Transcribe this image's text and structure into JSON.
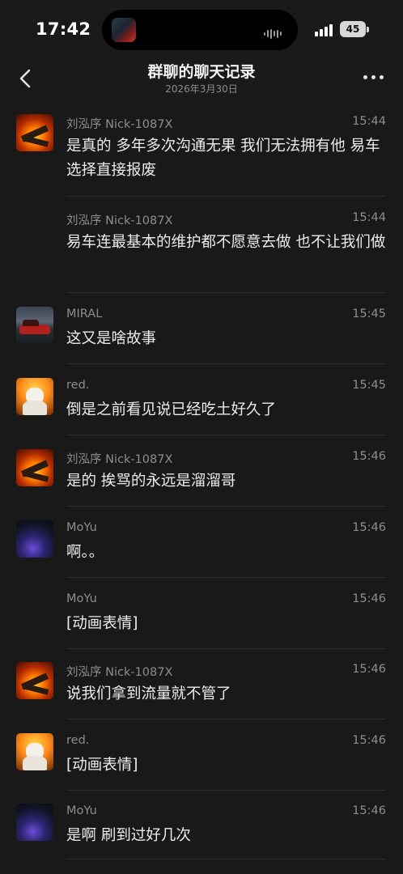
{
  "status_bar": {
    "time": "17:42",
    "battery": "45"
  },
  "header": {
    "title": "群聊的聊天记录",
    "subtitle": "2026年3月30日",
    "back_icon": "chevron-left-icon",
    "more_icon": "more-horizontal-icon"
  },
  "messages": [
    {
      "sender": "刘泓序 Nick-1087X",
      "time": "15:44",
      "text": "是真的 多年多次沟通无果 我们无法拥有他 易车选择直接报废",
      "avatar": "fire",
      "show_avatar": true
    },
    {
      "sender": "刘泓序 Nick-1087X",
      "time": "15:44",
      "text": "易车连最基本的维护都不愿意去做  也不让我们做",
      "avatar": "fire",
      "show_avatar": false
    },
    {
      "sender": "MIRAL",
      "time": "15:45",
      "text": "这又是啥故事",
      "avatar": "car",
      "show_avatar": true
    },
    {
      "sender": "red.",
      "time": "15:45",
      "text": "倒是之前看见说已经吃土好久了",
      "avatar": "cat",
      "show_avatar": true
    },
    {
      "sender": "刘泓序 Nick-1087X",
      "time": "15:46",
      "text": "是的  挨骂的永远是溜溜哥",
      "avatar": "fire",
      "show_avatar": true
    },
    {
      "sender": "MoYu",
      "time": "15:46",
      "text": "啊。。",
      "avatar": "dark",
      "show_avatar": true
    },
    {
      "sender": "MoYu",
      "time": "15:46",
      "text": "[动画表情]",
      "avatar": "dark",
      "show_avatar": false
    },
    {
      "sender": "刘泓序 Nick-1087X",
      "time": "15:46",
      "text": "说我们拿到流量就不管了",
      "avatar": "fire",
      "show_avatar": true
    },
    {
      "sender": "red.",
      "time": "15:46",
      "text": "[动画表情]",
      "avatar": "cat",
      "show_avatar": true
    },
    {
      "sender": "MoYu",
      "time": "15:46",
      "text": "是啊 刷到过好几次",
      "avatar": "dark",
      "show_avatar": true
    }
  ]
}
